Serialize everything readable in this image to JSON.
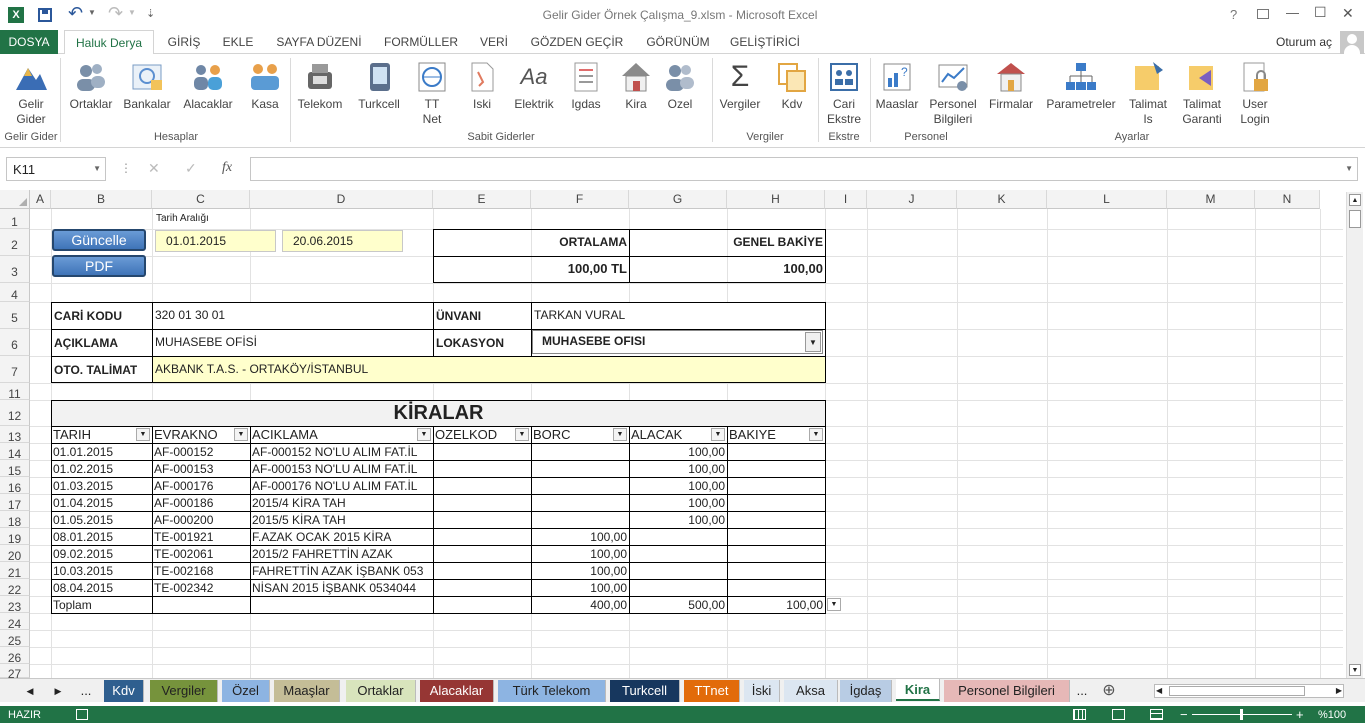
{
  "window": {
    "title": "Gelir Gider Örnek Çalışma_9.xlsm - Microsoft Excel",
    "help": "?",
    "min": "—",
    "max": "☐",
    "close": "✕",
    "undo": "↶",
    "redo": "↷",
    "customize": "⇣"
  },
  "tabs": {
    "file": "DOSYA",
    "items": [
      "Haluk Derya",
      "GİRİŞ",
      "EKLE",
      "SAYFA DÜZENİ",
      "FORMÜLLER",
      "VERİ",
      "GÖZDEN GEÇİR",
      "GÖRÜNÜM",
      "GELİŞTİRİCİ"
    ],
    "signin": "Oturum aç"
  },
  "ribbon": {
    "buttons": [
      [
        "Gelir",
        "Gider"
      ],
      [
        "Ortaklar"
      ],
      [
        "Bankalar"
      ],
      [
        "Alacaklar"
      ],
      [
        "Kasa"
      ],
      [
        "Telekom"
      ],
      [
        "Turkcell"
      ],
      [
        "TT",
        "Net"
      ],
      [
        "Iski"
      ],
      [
        "Elektrik"
      ],
      [
        "Igdas"
      ],
      [
        "Kira"
      ],
      [
        "Ozel"
      ],
      [
        "Vergiler"
      ],
      [
        "Kdv"
      ],
      [
        "Cari",
        "Ekstre"
      ],
      [
        "Maaslar"
      ],
      [
        "Personel",
        "Bilgileri"
      ],
      [
        "Firmalar"
      ],
      [
        "Parametreler"
      ],
      [
        "Talimat",
        "Is"
      ],
      [
        "Talimat",
        "Garanti"
      ],
      [
        "User",
        "Login"
      ]
    ],
    "groups": [
      "Gelir Gider",
      "Hesaplar",
      "Sabit Giderler",
      "Vergiler",
      "Ekstre",
      "Personel",
      "Ayarlar"
    ]
  },
  "formula_bar": {
    "name_box": "K11",
    "fx": "fx",
    "cancel": "✕",
    "enter": "✓",
    "content": ""
  },
  "columns": [
    "A",
    "B",
    "C",
    "D",
    "E",
    "F",
    "G",
    "H",
    "I",
    "J",
    "K",
    "L",
    "M",
    "N"
  ],
  "rows": [
    "1",
    "2",
    "3",
    "4",
    "5",
    "6",
    "7",
    "11",
    "12",
    "13",
    "14",
    "15",
    "16",
    "17",
    "18",
    "19",
    "20",
    "21",
    "22",
    "23",
    "24",
    "25",
    "26",
    "27"
  ],
  "sheet": {
    "date_range_label": "Tarih Aralığı",
    "update_button": "Güncelle",
    "pdf_button": "PDF",
    "date_from": "01.01.2015",
    "date_to": "20.06.2015",
    "avg_label": "ORTALAMA",
    "balance_label": "GENEL BAKİYE",
    "avg_value": "100,00 TL",
    "balance_value": "100,00",
    "cari_kodu_label": "CARİ KODU",
    "cari_kodu": "320 01 30 01",
    "unvani_label": "ÜNVANI",
    "unvani": "TARKAN VURAL",
    "aciklama_label": "AÇIKLAMA",
    "aciklama": "MUHASEBE OFİSİ",
    "lokasyon_label": "LOKASYON",
    "lokasyon": "MUHASEBE OFISI",
    "talimat_label": "OTO. TALİMAT",
    "talimat": "AKBANK T.A.S. - ORTAKÖY/İSTANBUL",
    "table_title": "KİRALAR",
    "headers": [
      "TARIH",
      "EVRAKNO",
      "ACIKLAMA",
      "OZELKOD",
      "BORC",
      "ALACAK",
      "BAKIYE"
    ],
    "rows": [
      [
        "01.01.2015",
        "AF-000152",
        "AF-000152 NO'LU ALIM FAT.İL",
        "",
        "",
        "100,00",
        ""
      ],
      [
        "01.02.2015",
        "AF-000153",
        "AF-000153 NO'LU ALIM FAT.İL",
        "",
        "",
        "100,00",
        ""
      ],
      [
        "01.03.2015",
        "AF-000176",
        "AF-000176 NO'LU ALIM FAT.İL",
        "",
        "",
        "100,00",
        ""
      ],
      [
        "01.04.2015",
        "AF-000186",
        "2015/4 KİRA TAH",
        "",
        "",
        "100,00",
        ""
      ],
      [
        "01.05.2015",
        "AF-000200",
        "2015/5 KİRA TAH",
        "",
        "",
        "100,00",
        ""
      ],
      [
        "08.01.2015",
        "TE-001921",
        "F.AZAK OCAK 2015 KİRA",
        "",
        "100,00",
        "",
        ""
      ],
      [
        "09.02.2015",
        "TE-002061",
        "2015/2 FAHRETTİN AZAK",
        "",
        "100,00",
        "",
        ""
      ],
      [
        "10.03.2015",
        "TE-002168",
        "FAHRETTİN AZAK İŞBANK 053",
        "",
        "100,00",
        "",
        ""
      ],
      [
        "08.04.2015",
        "TE-002342",
        "NİSAN 2015 İŞBANK 0534044",
        "",
        "100,00",
        "",
        ""
      ]
    ],
    "total_label": "Toplam",
    "total_borc": "400,00",
    "total_alacak": "500,00",
    "total_bakiye": "100,00"
  },
  "sheet_tabs": {
    "nav_prev": "◀",
    "nav_next": "▶",
    "more": "...",
    "items": [
      {
        "label": "Kdv",
        "bg": "#2f5f8f",
        "fg": "#ffffff"
      },
      {
        "label": "Vergiler",
        "bg": "#76933c",
        "fg": "#222222"
      },
      {
        "label": "Özel",
        "bg": "#8db4e2",
        "fg": "#222222"
      },
      {
        "label": "Maaşlar",
        "bg": "#c4bd97",
        "fg": "#222222"
      },
      {
        "label": "Ortaklar",
        "bg": "#d8e4bc",
        "fg": "#222222"
      },
      {
        "label": "Alacaklar",
        "bg": "#963634",
        "fg": "#ffffff"
      },
      {
        "label": "Türk Telekom",
        "bg": "#8db4e2",
        "fg": "#222222"
      },
      {
        "label": "Turkcell",
        "bg": "#17375e",
        "fg": "#ffffff"
      },
      {
        "label": "TTnet",
        "bg": "#e26b0a",
        "fg": "#ffffff"
      },
      {
        "label": "İski",
        "bg": "#dce6f1",
        "fg": "#222222"
      },
      {
        "label": "Aksa",
        "bg": "#dce6f1",
        "fg": "#222222"
      },
      {
        "label": "İgdaş",
        "bg": "#b8cce4",
        "fg": "#222222"
      },
      {
        "label": "Kira",
        "bg": "#ffffff",
        "fg": "#217346"
      },
      {
        "label": "Personel Bilgileri",
        "bg": "#e6b8b7",
        "fg": "#222222"
      }
    ],
    "more_right": "...",
    "add": "⊕"
  },
  "status": {
    "ready": "HAZIR",
    "zoom": "%100",
    "minus": "−",
    "plus": "+"
  },
  "colors": {
    "excel_green": "#217346",
    "accent": "#2b579a"
  }
}
